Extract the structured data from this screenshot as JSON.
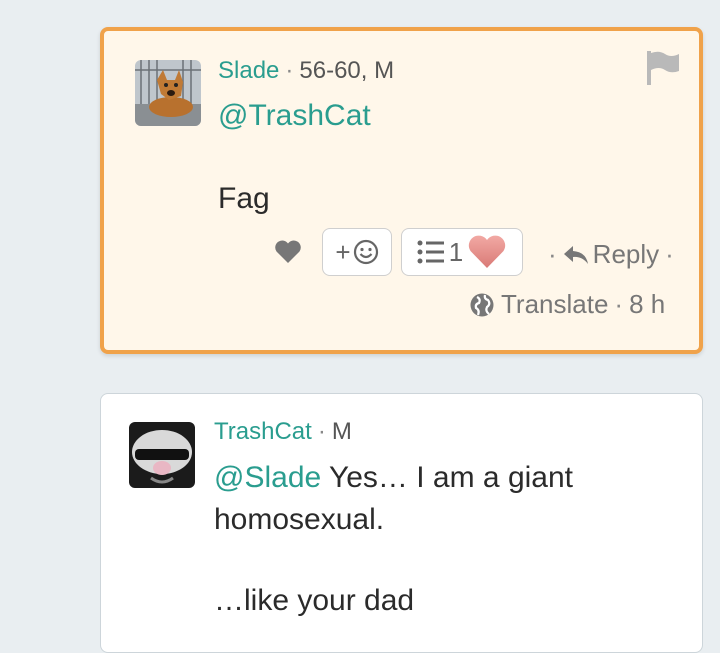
{
  "comment1": {
    "username": "Slade",
    "meta": "56-60, M",
    "mention": "@TrashCat",
    "text": "Fag",
    "list_count": "1",
    "reply_label": "Reply",
    "translate_label": "Translate",
    "time": "8 h"
  },
  "comment2": {
    "username": "TrashCat",
    "meta": "M",
    "mention": "@Slade",
    "text_line1": " Yes… I am a giant",
    "text_line2": "homosexual.",
    "text_line3": "…like your dad"
  },
  "icons": [
    "flag-icon",
    "heart-icon",
    "emoji-add-icon",
    "list-icon",
    "pink-heart-icon",
    "reply-arrow-icon",
    "globe-icon"
  ],
  "colors": {
    "accent": "#2a9d8f",
    "highlight_border": "#f0a24a",
    "highlight_bg": "#fff7ea"
  }
}
